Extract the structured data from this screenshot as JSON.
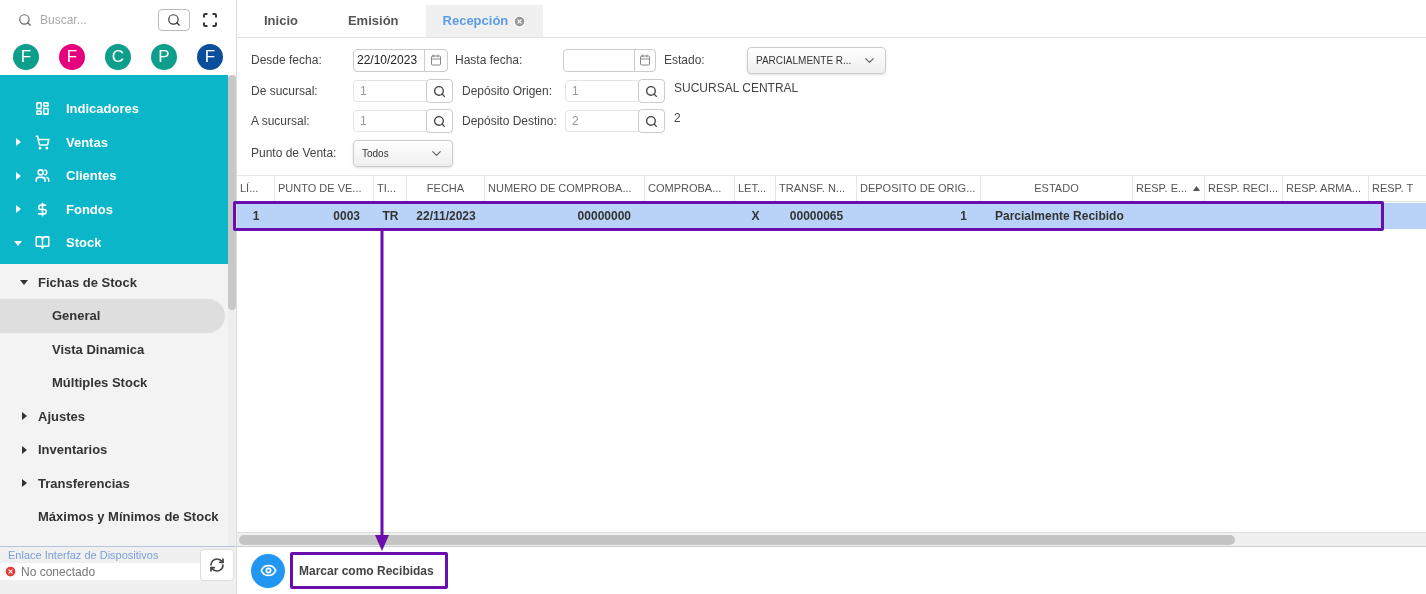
{
  "sidebar": {
    "search": {
      "placeholder": "Buscar..."
    },
    "shortcuts": [
      {
        "letter": "F",
        "color": "#0e9e8c"
      },
      {
        "letter": "F",
        "color": "#e5007d"
      },
      {
        "letter": "C",
        "color": "#0e9e8c"
      },
      {
        "letter": "P",
        "color": "#0e9e8c"
      },
      {
        "letter": "F",
        "color": "#0b4f9c"
      }
    ],
    "menu": [
      {
        "label": "Indicadores",
        "kind": "dashboard"
      },
      {
        "label": "Ventas",
        "kind": "cart",
        "expanded": false
      },
      {
        "label": "Clientes",
        "kind": "people",
        "expanded": false
      },
      {
        "label": "Fondos",
        "kind": "dollar",
        "expanded": false
      },
      {
        "label": "Stock",
        "kind": "book",
        "expanded": true,
        "children": [
          {
            "label": "Fichas de Stock",
            "expanded": true,
            "children": [
              {
                "label": "General",
                "selected": true
              },
              {
                "label": "Vista Dinamica",
                "selected": false
              },
              {
                "label": "Múltiples Stock",
                "selected": false
              }
            ]
          },
          {
            "label": "Ajustes",
            "expanded": false
          },
          {
            "label": "Inventarios",
            "expanded": false
          },
          {
            "label": "Transferencias",
            "expanded": false
          },
          {
            "label": "Máximos y Mínimos de Stock"
          }
        ]
      }
    ],
    "device_link": {
      "title": "Enlace Interfaz de Dispositivos",
      "status": "No conectado",
      "connected": false
    }
  },
  "tabs": [
    {
      "label": "Inicio",
      "selected": false
    },
    {
      "label": "Emisión",
      "selected": false
    },
    {
      "label": "Recepción",
      "selected": true,
      "closable": true
    }
  ],
  "filters": {
    "desde_fecha": {
      "label": "Desde fecha:",
      "value": "22/10/2023"
    },
    "hasta_fecha": {
      "label": "Hasta fecha:"
    },
    "estado": {
      "label": "Estado:",
      "value": "PARCIALMENTE R..."
    },
    "de_sucursal": {
      "label": "De sucursal:",
      "placeholder": "1"
    },
    "deposito_origen": {
      "label": "Depósito Origen:",
      "placeholder": "1",
      "description": "SUCURSAL CENTRAL"
    },
    "a_sucursal": {
      "label": "A sucursal:",
      "placeholder": "1"
    },
    "deposito_destino": {
      "label": "Depósito Destino:",
      "placeholder": "2",
      "description": "2"
    },
    "punto_de_venta": {
      "label": "Punto de Venta:",
      "value": "Todos"
    }
  },
  "table": {
    "columns": [
      {
        "label": "LÍ..."
      },
      {
        "label": "PUNTO DE VE..."
      },
      {
        "label": "TI..."
      },
      {
        "label": "FECHA"
      },
      {
        "label": "NUMERO DE COMPROBA..."
      },
      {
        "label": "COMPROBA..."
      },
      {
        "label": "LET..."
      },
      {
        "label": "TRANSF. N..."
      },
      {
        "label": "DEPOSITO DE ORIG..."
      },
      {
        "label": "ESTADO"
      },
      {
        "label": "RESP. E...",
        "sorted": true
      },
      {
        "label": "RESP. RECI..."
      },
      {
        "label": "RESP. ARMA..."
      },
      {
        "label": "RESP. T"
      }
    ],
    "rows": [
      {
        "selected": true,
        "cells": [
          "1",
          "0003",
          "TR",
          "22/11/2023",
          "00000000",
          "",
          "X",
          "00000065",
          "1",
          "Parcialmente Recibido",
          "",
          "",
          "",
          ""
        ]
      }
    ]
  },
  "actions": [
    {
      "label": "Marcar como Recibidas"
    }
  ]
}
